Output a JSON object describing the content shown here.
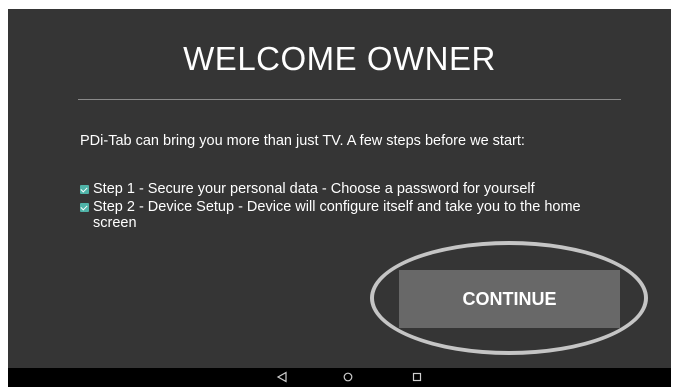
{
  "welcome": {
    "title": "WELCOME OWNER",
    "intro": "PDi-Tab can bring you more than just TV. A few steps before we start:",
    "steps": [
      {
        "checked": true,
        "text": "Step 1 - Secure your personal data - Choose a password for yourself"
      },
      {
        "checked": true,
        "text": "Step 2 - Device Setup - Device will configure itself and take you to the home screen"
      }
    ],
    "continue_label": "CONTINUE"
  },
  "navbar": {
    "icons": [
      "back-icon",
      "home-icon",
      "recent-apps-icon"
    ]
  },
  "colors": {
    "screen_bg": "#353535",
    "button_bg": "#686868",
    "checkbox": "#4fb3a8",
    "highlight_oval": "#c5c5c5",
    "navbar_bg": "#000000"
  }
}
